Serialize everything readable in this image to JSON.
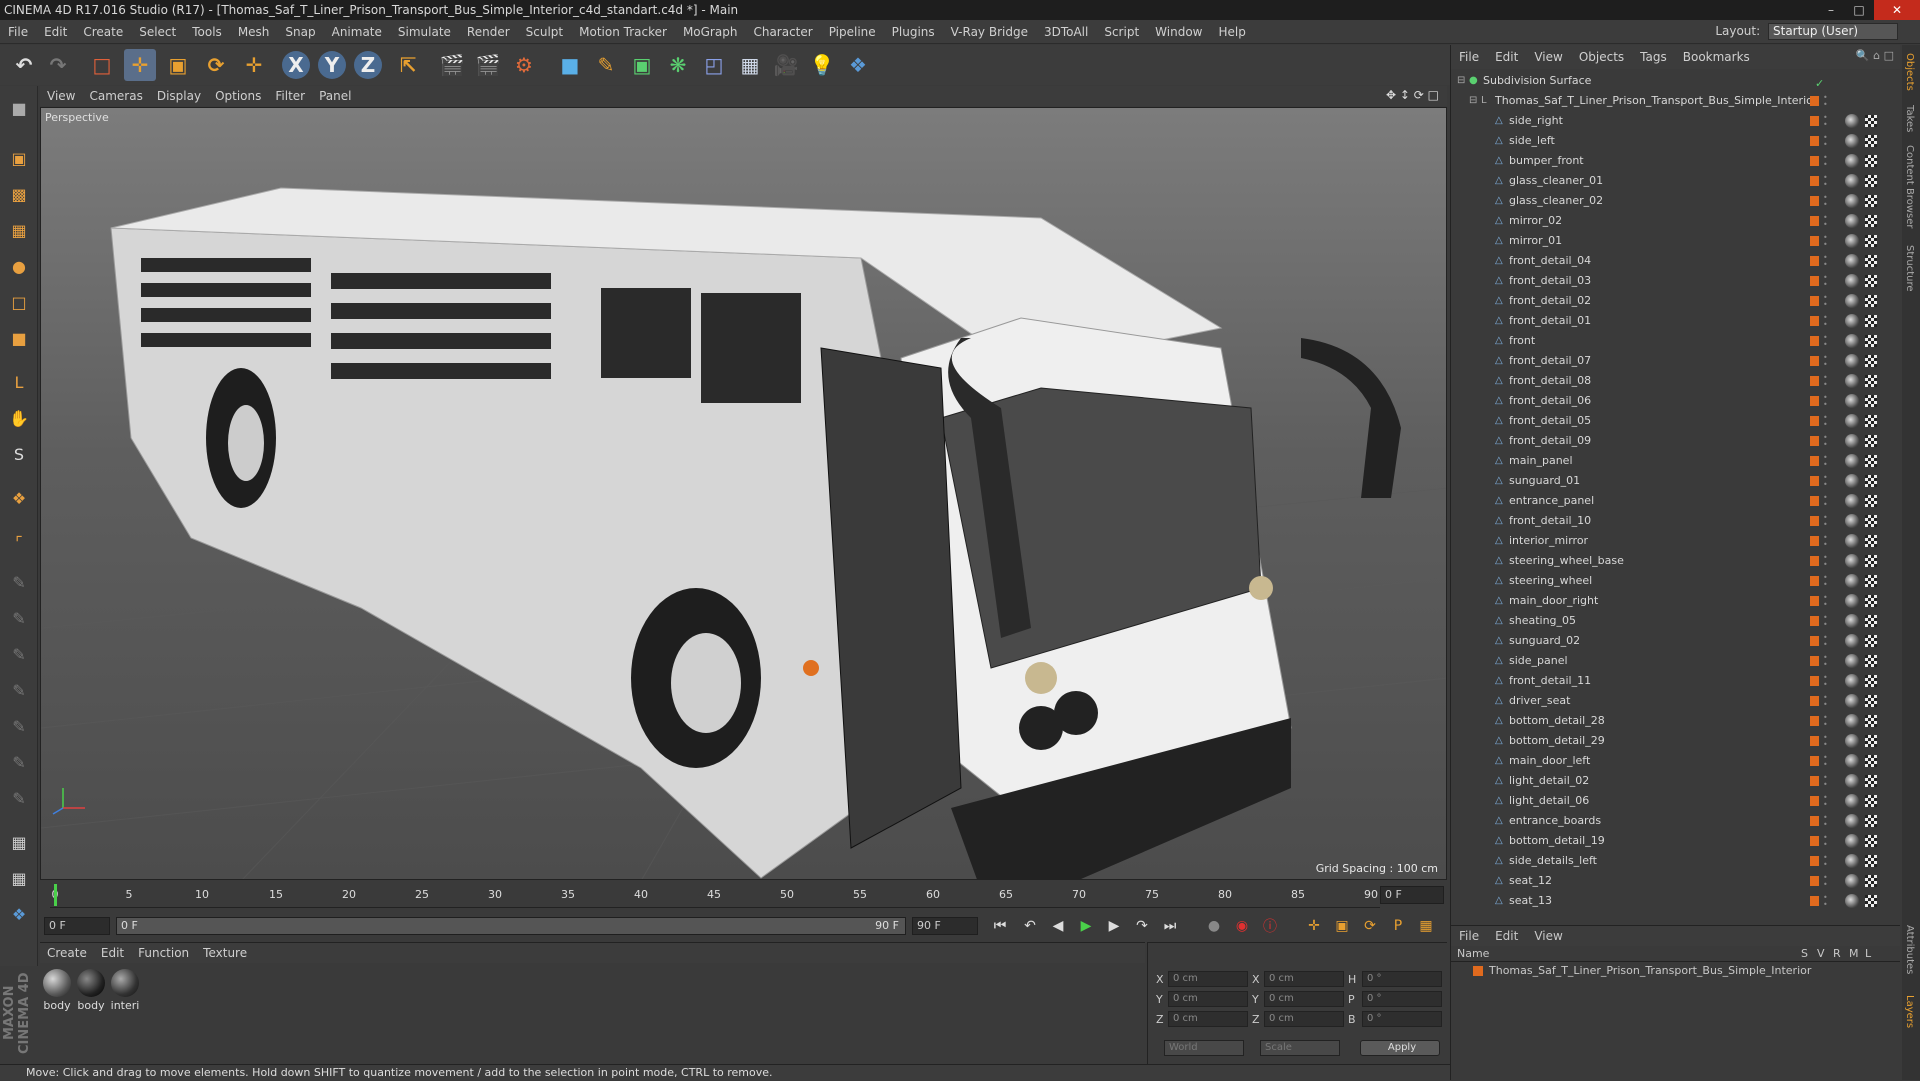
{
  "window": {
    "title": "CINEMA 4D R17.016 Studio (R17) - [Thomas_Saf_T_Liner_Prison_Transport_Bus_Simple_Interior_c4d_standart.c4d *] - Main"
  },
  "menu": [
    "File",
    "Edit",
    "Create",
    "Select",
    "Tools",
    "Mesh",
    "Snap",
    "Animate",
    "Simulate",
    "Render",
    "Sculpt",
    "Motion Tracker",
    "MoGraph",
    "Character",
    "Pipeline",
    "Plugins",
    "V-Ray Bridge",
    "3DToAll",
    "Script",
    "Window",
    "Help"
  ],
  "layout": {
    "label": "Layout:",
    "value": "Startup (User)"
  },
  "viewport": {
    "menu": [
      "View",
      "Cameras",
      "Display",
      "Options",
      "Filter",
      "Panel"
    ],
    "label": "Perspective",
    "grid_spacing": "Grid Spacing : 100 cm"
  },
  "timeline": {
    "ticks": [
      "0",
      "5",
      "10",
      "15",
      "20",
      "25",
      "30",
      "35",
      "40",
      "45",
      "50",
      "55",
      "60",
      "65",
      "70",
      "75",
      "80",
      "85",
      "90"
    ],
    "end_frame": "0 F"
  },
  "transport": {
    "start": "0 F",
    "range_start": "0 F",
    "range_end": "90 F",
    "end": "90 F"
  },
  "materials": {
    "menu": [
      "Create",
      "Edit",
      "Function",
      "Texture"
    ],
    "items": [
      "body",
      "body",
      "interi"
    ]
  },
  "coords": {
    "x": "0 cm",
    "y": "0 cm",
    "z": "0 cm",
    "x2": "0 cm",
    "y2": "0 cm",
    "z2": "0 cm",
    "h": "0 °",
    "p": "0 °",
    "b": "0 °",
    "labels": [
      "X",
      "Y",
      "Z",
      "X",
      "Y",
      "Z",
      "H",
      "P",
      "B"
    ],
    "world": "World",
    "scale": "Scale",
    "apply": "Apply"
  },
  "status": "Move: Click and drag to move elements. Hold down SHIFT to quantize movement / add to the selection in point mode, CTRL to remove.",
  "objects": {
    "menu": [
      "File",
      "Edit",
      "View",
      "Objects",
      "Tags",
      "Bookmarks"
    ],
    "root": "Subdivision Surface",
    "group": "Thomas_Saf_T_Liner_Prison_Transport_Bus_Simple_Interior",
    "items": [
      "side_right",
      "side_left",
      "bumper_front",
      "glass_cleaner_01",
      "glass_cleaner_02",
      "mirror_02",
      "mirror_01",
      "front_detail_04",
      "front_detail_03",
      "front_detail_02",
      "front_detail_01",
      "front",
      "front_detail_07",
      "front_detail_08",
      "front_detail_06",
      "front_detail_05",
      "front_detail_09",
      "main_panel",
      "sunguard_01",
      "entrance_panel",
      "front_detail_10",
      "interior_mirror",
      "steering_wheel_base",
      "steering_wheel",
      "main_door_right",
      "sheating_05",
      "sunguard_02",
      "side_panel",
      "front_detail_11",
      "driver_seat",
      "bottom_detail_28",
      "bottom_detail_29",
      "main_door_left",
      "light_detail_02",
      "light_detail_06",
      "entrance_boards",
      "bottom_detail_19",
      "side_details_left",
      "seat_12",
      "seat_13"
    ]
  },
  "layers": {
    "menu": [
      "File",
      "Edit",
      "View"
    ],
    "columns": [
      "Name",
      "S",
      "V",
      "R",
      "M",
      "L"
    ],
    "row": "Thomas_Saf_T_Liner_Prison_Transport_Bus_Simple_Interior"
  },
  "sidetabs": [
    "Objects",
    "Takes",
    "Content Browser",
    "Structure",
    "Attributes",
    "Layers"
  ],
  "brand": "MAXON CINEMA 4D"
}
